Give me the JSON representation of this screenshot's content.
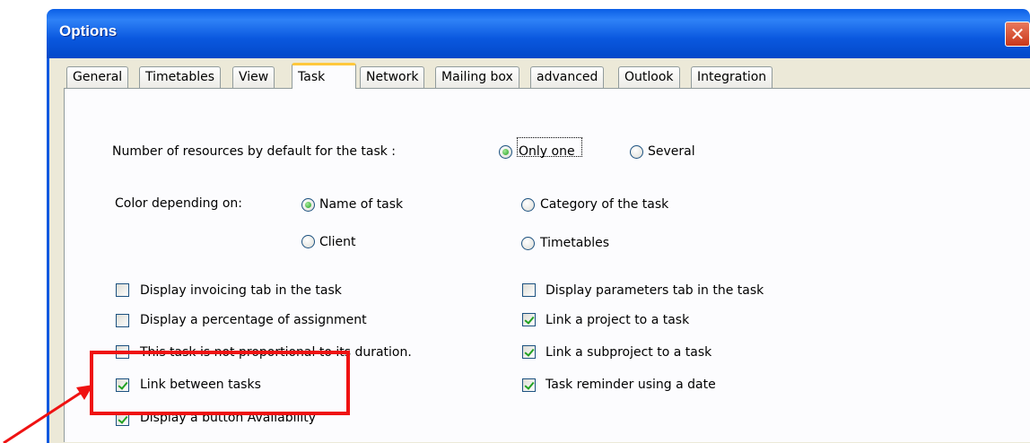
{
  "window": {
    "title": "Options",
    "close_glyph": "✕"
  },
  "tabs": [
    {
      "label": "General",
      "active": false
    },
    {
      "label": "Timetables",
      "active": false
    },
    {
      "label": "View",
      "active": false
    },
    {
      "label": "Task",
      "active": true
    },
    {
      "label": "Network",
      "active": false
    },
    {
      "label": "Mailing box",
      "active": false
    },
    {
      "label": "advanced",
      "active": false
    },
    {
      "label": "Outlook",
      "active": false
    },
    {
      "label": "Integration",
      "active": false
    }
  ],
  "resources": {
    "label": "Number of resources by default for the task :",
    "options": [
      {
        "label": "Only one",
        "checked": true
      },
      {
        "label": "Several",
        "checked": false
      }
    ]
  },
  "color": {
    "label": "Color depending on:",
    "options": [
      {
        "label": "Name of task",
        "checked": true
      },
      {
        "label": "Category of the task",
        "checked": false
      },
      {
        "label": "Client",
        "checked": false
      },
      {
        "label": "Timetables",
        "checked": false
      }
    ]
  },
  "checkboxes_left": [
    {
      "label": "Display invoicing tab in the task",
      "checked": false
    },
    {
      "label": "Display a percentage of assignment",
      "checked": false
    },
    {
      "label": "This task is not proportional to its duration.",
      "checked": false
    },
    {
      "label": "Link between tasks",
      "checked": true
    },
    {
      "label": "Display a button Availability",
      "checked": true
    }
  ],
  "checkboxes_right": [
    {
      "label": "Display parameters tab in the task",
      "checked": false
    },
    {
      "label": "Link a project to a task",
      "checked": true
    },
    {
      "label": "Link a subproject to a task",
      "checked": true
    },
    {
      "label": "Task reminder using a date",
      "checked": true
    }
  ],
  "annotation": {
    "color": "#ef1212"
  }
}
